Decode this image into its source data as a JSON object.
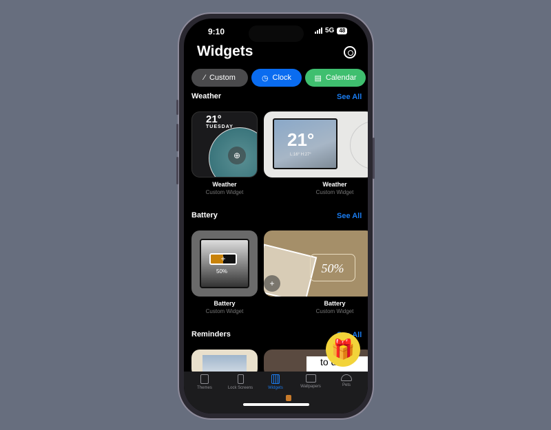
{
  "status": {
    "time": "9:10",
    "network": "5G",
    "battery": "48"
  },
  "header": {
    "title": "Widgets",
    "settings_icon": "gear-icon"
  },
  "categories": [
    {
      "label": "Custom",
      "icon": "pencil-icon",
      "color": "#4a4a4c"
    },
    {
      "label": "Clock",
      "icon": "clock-icon",
      "color": "#0a6cf0"
    },
    {
      "label": "Calendar",
      "icon": "calendar-icon",
      "color": "#3fbf6f"
    }
  ],
  "sections": [
    {
      "title": "Weather",
      "see_all": "See All",
      "items": [
        {
          "name": "Weather",
          "sub": "Custom Widget",
          "temp": "21°",
          "day": "TUESDAY"
        },
        {
          "name": "Weather",
          "sub": "Custom Widget",
          "temp": "21°",
          "range": "L:16° H:27°"
        }
      ]
    },
    {
      "title": "Battery",
      "see_all": "See All",
      "items": [
        {
          "name": "Battery",
          "sub": "Custom Widget",
          "level": "50%"
        },
        {
          "name": "Battery",
          "sub": "Custom Widget",
          "level": "50%"
        }
      ]
    },
    {
      "title": "Reminders",
      "see_all": "See All",
      "items": [
        {
          "text": ""
        },
        {
          "text": "to do"
        }
      ]
    }
  ],
  "tabs": [
    {
      "label": "Themes",
      "icon": "themes-icon"
    },
    {
      "label": "Lock Screens",
      "icon": "phone-lock-icon"
    },
    {
      "label": "Widgets",
      "icon": "widgets-grid-icon",
      "active": true
    },
    {
      "label": "Wallpapers",
      "icon": "image-icon"
    },
    {
      "label": "Pets",
      "icon": "turtle-icon"
    }
  ],
  "colors": {
    "accent": "#1a7cf0",
    "background": "#676e7e"
  }
}
